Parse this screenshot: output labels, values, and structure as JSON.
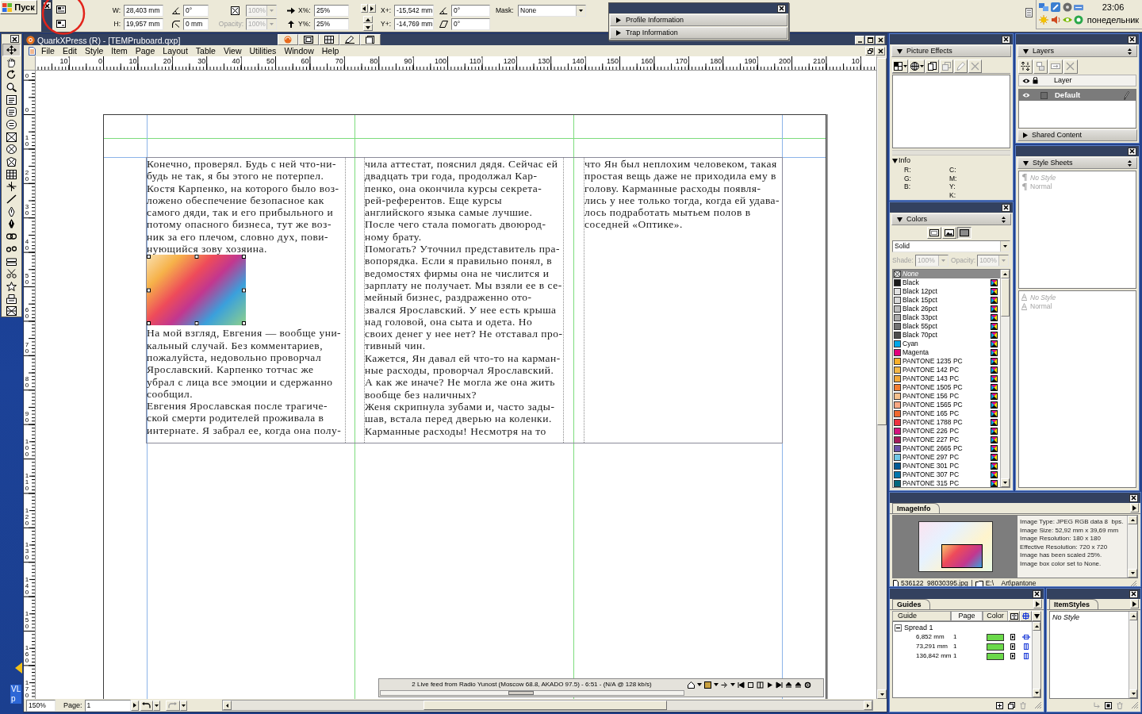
{
  "start_button": {
    "label": "Пуск"
  },
  "measurements": {
    "w": {
      "label": "W:",
      "value": "28,403 mm"
    },
    "h": {
      "label": "H:",
      "value": "19,957 mm"
    },
    "box_angle": {
      "value": "0°"
    },
    "corner_radius": {
      "value": "0 mm"
    },
    "shade": {
      "value": "100%",
      "disabled": true
    },
    "opacity": {
      "label": "Opacity:",
      "value": "100%",
      "disabled": true
    },
    "scale_x": {
      "label": "X%:",
      "value": "25%"
    },
    "scale_y": {
      "label": "Y%:",
      "value": "25%"
    },
    "offset_x": {
      "label": "X+:",
      "value": "-15,542 mm"
    },
    "offset_y": {
      "label": "Y+:",
      "value": "-14,769 mm"
    },
    "picture_angle": {
      "value": "0°"
    },
    "picture_skew": {
      "value": "0°"
    },
    "mask": {
      "label": "Mask:",
      "value": "None"
    }
  },
  "floating_palette": {
    "sections": [
      {
        "label": "Profile Information",
        "expanded": false
      },
      {
        "label": "Trap Information",
        "expanded": false
      }
    ]
  },
  "tray": {
    "time": "23:06",
    "day": "понедельник"
  },
  "desktop": {
    "icon_label": {
      "lines": [
        "VL",
        "p"
      ]
    }
  },
  "tools": [
    {
      "selected": true
    },
    {
      "selected": false
    },
    {
      "selected": false
    },
    {
      "selected": false
    },
    {
      "selected": false
    },
    {
      "selected": false
    },
    {
      "selected": false
    },
    {
      "selected": false
    },
    {
      "selected": false
    },
    {
      "selected": false
    },
    {
      "selected": false
    },
    {
      "selected": false
    },
    {
      "selected": false
    },
    {
      "selected": false
    },
    {
      "selected": false
    },
    {
      "selected": false
    },
    {
      "selected": false
    },
    {
      "selected": false
    },
    {
      "selected": false
    },
    {
      "selected": false
    },
    {
      "selected": false
    },
    {
      "selected": false
    }
  ],
  "document_window": {
    "title": "QuarkXPress (R) - [TEMPruboard.qxp]",
    "menu": [
      "File",
      "Edit",
      "Style",
      "Item",
      "Page",
      "Layout",
      "Table",
      "View",
      "Utilities",
      "Window",
      "Help"
    ],
    "ruler_h": [
      "10",
      "0",
      "10",
      "20",
      "30",
      "40",
      "50",
      "60",
      "70",
      "80",
      "90",
      "100",
      "110",
      "120",
      "130",
      "140",
      "150",
      "160",
      "170",
      "180",
      "190",
      "200",
      "210",
      "10"
    ],
    "ruler_v": [
      "0",
      "0",
      "10",
      "20",
      "30",
      "40",
      "50",
      "60",
      "70",
      "80",
      "90",
      "100",
      "110",
      "120",
      "130",
      "140",
      "150",
      "160",
      "170"
    ],
    "columns": [
      {
        "blocks": [
          {
            "kind": "paragraph",
            "lines": [
              "Конечно, проверял. Будь с ней что-ни-",
              "будь не так, я бы этого не потерпел.",
              "Костя Карпенко, на которого было воз-",
              "ложено обеспечение безопасное как",
              "самого дяди, так и его прибыльного и",
              "потому опасного бизнеса, тут же воз-",
              "ник за его плечом, словно дух, пови-",
              "нующийся зову хозяина."
            ]
          },
          {
            "kind": "picture",
            "selected": true
          },
          {
            "kind": "paragraph",
            "lines": [
              "На мой взгляд, Евгения — вообще уни-",
              "кальный случай. Без комментариев,",
              "пожалуйста, недовольно проворчал",
              "Ярославский. Карпенко тотчас же",
              "убрал с лица все эмоции и сдержанно",
              "сообщил."
            ]
          },
          {
            "kind": "paragraph",
            "lines": [
              "Евгения Ярославская после трагиче-",
              "ской смерти родителей проживала в",
              "интернате. Я забрал ее, когда она полу-"
            ]
          }
        ]
      },
      {
        "blocks": [
          {
            "kind": "paragraph",
            "lines": [
              "чила аттестат, пояснил дядя. Сейчас ей",
              "двадцать три года, продолжал Кар-",
              "пенко, она окончила курсы секрета-",
              "рей-референтов. Еще курсы",
              "английского языка самые лучшие.",
              "После чего стала помогать двоюрод-",
              "ному брату."
            ]
          },
          {
            "kind": "paragraph",
            "lines": [
              "Помогать? Уточнил представитель пра-",
              "вопорядка. Если я правильно понял, в",
              "ведомостях фирмы она не числится и",
              "зарплату не получает. Мы взяли ее в се-",
              "мейный бизнес, раздраженно ото-",
              "звался Ярославский. У нее есть крыша",
              "над головой, она сыта и одета. Но",
              "своих денег у нее нет? Не отставал про-",
              "тивный чин."
            ]
          },
          {
            "kind": "paragraph",
            "lines": [
              "Кажется, Ян давал ей что-то на карман-",
              "ные расходы, проворчал Ярославский.",
              "А как же иначе? Не могла же она жить",
              "вообще без наличных?"
            ]
          },
          {
            "kind": "paragraph",
            "lines": [
              "Женя скрипнула зубами и, часто зады-",
              "шав, встала перед дверью на коленки.",
              "Карманные расходы! Несмотря на то"
            ]
          }
        ]
      },
      {
        "blocks": [
          {
            "kind": "paragraph",
            "lines": [
              "что Ян был неплохим человеком, такая",
              "простая вещь даже не приходила ему в",
              "голову. Карманные расходы появля-",
              "лись у нее только тогда, когда ей удава-",
              "лось подработать мытьем полов в",
              "соседней «Оптике»."
            ]
          }
        ]
      }
    ],
    "media_bar": {
      "text": "2 Live feed from Radio Yunost (Moscow 68.8, AKADO 97.5) - 6:51 - (N/A @ 128 kb/s)",
      "seek": {
        "level": 0.46
      }
    },
    "status": {
      "zoom": "150%",
      "page_label": "Page:",
      "page": "1"
    }
  },
  "picture_effects": {
    "title": "Picture Effects",
    "expanded": true,
    "info": {
      "title": "Info",
      "expanded": true,
      "rgb": [
        "R:",
        "G:",
        "B:"
      ],
      "cmyk": [
        "C:",
        "M:",
        "Y:",
        "K:"
      ]
    }
  },
  "colors": {
    "title": "Colors",
    "expanded": true,
    "targets": [
      {
        "selected": false
      },
      {
        "selected": false
      },
      {
        "selected": true
      }
    ],
    "mode": "Solid",
    "shade": {
      "label": "Shade:",
      "value": "100%",
      "disabled": true
    },
    "opacity": {
      "label": "Opacity:",
      "value": "100%",
      "disabled": true
    },
    "items": [
      {
        "name": "None",
        "kind": "none",
        "selected": true
      },
      {
        "name": "Black",
        "kind": "color",
        "color": "#1a1a1a",
        "selected": false
      },
      {
        "name": "Black 12pct",
        "kind": "color",
        "color": "#e1e1e1",
        "selected": false
      },
      {
        "name": "Black 15pct",
        "kind": "color",
        "color": "#d9d9d9",
        "selected": false
      },
      {
        "name": "Black 26pct",
        "kind": "color",
        "color": "#bdbdbd",
        "selected": false
      },
      {
        "name": "Black 33pct",
        "kind": "color",
        "color": "#ababab",
        "selected": false
      },
      {
        "name": "Black 55pct",
        "kind": "color",
        "color": "#737373",
        "selected": false
      },
      {
        "name": "Black 70pct",
        "kind": "color",
        "color": "#4d4d4d",
        "selected": false
      },
      {
        "name": "Cyan",
        "kind": "color",
        "color": "#00a8e8",
        "selected": false
      },
      {
        "name": "Magenta",
        "kind": "color",
        "color": "#e4007c",
        "selected": false
      },
      {
        "name": "PANTONE 1235 PC",
        "kind": "color",
        "color": "#f8b02a",
        "selected": false
      },
      {
        "name": "PANTONE 142 PC",
        "kind": "color",
        "color": "#f4b847",
        "selected": false
      },
      {
        "name": "PANTONE 143 PC",
        "kind": "color",
        "color": "#f2a93b",
        "selected": false
      },
      {
        "name": "PANTONE 1505 PC",
        "kind": "color",
        "color": "#f47c30",
        "selected": false
      },
      {
        "name": "PANTONE 156 PC",
        "kind": "color",
        "color": "#f5c08c",
        "selected": false
      },
      {
        "name": "PANTONE 1565 PC",
        "kind": "color",
        "color": "#f9a882",
        "selected": false
      },
      {
        "name": "PANTONE 165 PC",
        "kind": "color",
        "color": "#f26a2e",
        "selected": false
      },
      {
        "name": "PANTONE 1788 PC",
        "kind": "color",
        "color": "#ee3340",
        "selected": false
      },
      {
        "name": "PANTONE 226 PC",
        "kind": "color",
        "color": "#d5147e",
        "selected": false
      },
      {
        "name": "PANTONE 227 PC",
        "kind": "color",
        "color": "#a61c5c",
        "selected": false
      },
      {
        "name": "PANTONE 2665 PC",
        "kind": "color",
        "color": "#6b54a8",
        "selected": false
      },
      {
        "name": "PANTONE 297 PC",
        "kind": "color",
        "color": "#6fc7e8",
        "selected": false
      },
      {
        "name": "PANTONE 301 PC",
        "kind": "color",
        "color": "#005a96",
        "selected": false
      },
      {
        "name": "PANTONE 307 PC",
        "kind": "color",
        "color": "#0076ac",
        "selected": false
      },
      {
        "name": "PANTONE 315 PC",
        "kind": "color",
        "color": "#00687e",
        "selected": false
      }
    ]
  },
  "layers": {
    "title": "Layers",
    "expanded": true,
    "column": "Layer",
    "items": [
      {
        "name": "Default",
        "selected": true,
        "visible": true
      }
    ],
    "shared": {
      "title": "Shared Content",
      "expanded": false
    }
  },
  "style_sheets": {
    "title": "Style Sheets",
    "expanded": true,
    "paragraph_styles": [
      {
        "name": "No Style",
        "kind": "none"
      },
      {
        "name": "Normal",
        "kind": "style"
      }
    ],
    "character_styles": [
      {
        "name": "No Style",
        "kind": "none"
      },
      {
        "name": "Normal",
        "kind": "style"
      }
    ]
  },
  "image_info": {
    "tab": "ImageInfo",
    "lines": [
      "Image Type: JPEG RGB data 8  bps.",
      "Image Size: 52,92 mm x 39,69 mm",
      "Image Resolution: 180 x 180",
      "Effective Resolution: 720 x 720",
      "Image has been scaled 25%.",
      "Image box color set to None."
    ],
    "file": "536122_98030395.jpg",
    "folder": "E:\\__Art\\pantone"
  },
  "guides": {
    "tab": "Guides",
    "columns": [
      "Guide",
      "Page",
      "Color"
    ],
    "spread": {
      "label": "Spread 1",
      "expanded": true
    },
    "rows": [
      {
        "position": "6,852 mm",
        "page": "1",
        "kind": "horizontal"
      },
      {
        "position": "73,291 mm",
        "page": "1",
        "kind": "vertical"
      },
      {
        "position": "136,842 mm",
        "page": "1",
        "kind": "vertical"
      }
    ]
  },
  "item_styles": {
    "tab": "ItemStyles",
    "items": [
      {
        "name": "No Style",
        "kind": "none"
      }
    ]
  }
}
